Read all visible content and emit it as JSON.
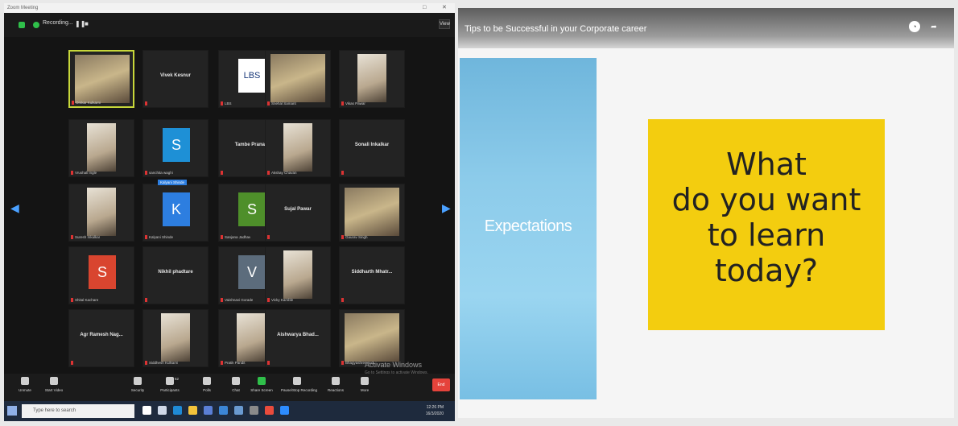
{
  "zoom": {
    "window_title": "Zoom Meeting",
    "window_controls": [
      "□",
      "✕"
    ],
    "recording_label": "Recording...",
    "view_label": "View",
    "watermark_title": "Activate Windows",
    "watermark_sub": "Go to Settings to activate Windows.",
    "tiles": [
      {
        "name": "Omkar Kulkarni",
        "kind": "photo",
        "active": true
      },
      {
        "name": "Vivek Kesnur",
        "kind": "name"
      },
      {
        "name": "LBS",
        "kind": "logo",
        "letters": "LBS"
      },
      {
        "name": "Snehal Samant",
        "kind": "photo"
      },
      {
        "name": "Vikas Pawar",
        "kind": "tallphoto"
      },
      {
        "name": "Vrushali Ingle",
        "kind": "tallphoto"
      },
      {
        "name": "sanchita waghi",
        "kind": "avatar",
        "letter": "S",
        "color": "#1e90d6"
      },
      {
        "name": "Tambe Pranav",
        "kind": "name"
      },
      {
        "name": "Akshay Chavan",
        "kind": "tallphoto"
      },
      {
        "name": "Sonali Inkalkar",
        "kind": "name"
      },
      {
        "name": "Suresh Inkalkar",
        "kind": "tallphoto"
      },
      {
        "name": "Kalyani Shinde",
        "kind": "avatar",
        "letter": "K",
        "color": "#2d7ee0",
        "badge": "Kalyani Shinde"
      },
      {
        "name": "Sanjana Jadhav",
        "kind": "avatar",
        "letter": "S",
        "color": "#4e8f2a"
      },
      {
        "name": "Sujal Pawar",
        "kind": "name"
      },
      {
        "name": "Gaurav Singh",
        "kind": "photo"
      },
      {
        "name": "Shital Kachare",
        "kind": "avatar",
        "letter": "S",
        "color": "#d9452f"
      },
      {
        "name": "Nikhil phadtare",
        "kind": "name"
      },
      {
        "name": "Vaishnavi Gorade",
        "kind": "avatar",
        "letter": "V",
        "color": "#5c6c7c"
      },
      {
        "name": "Vicky Kamble",
        "kind": "tallphoto"
      },
      {
        "name": "Siddharth Mhatr...",
        "kind": "name"
      },
      {
        "name": "Agr Ramesh Nag...",
        "kind": "name"
      },
      {
        "name": "Siddhesh Kulkarni",
        "kind": "tallphoto"
      },
      {
        "name": "Pratik Pandit",
        "kind": "tallphoto"
      },
      {
        "name": "Aishwarya Bhad...",
        "kind": "name"
      },
      {
        "name": "Bhagyashree sud...",
        "kind": "photo"
      }
    ],
    "toolbar": [
      {
        "label": "Unmute",
        "icon": "microphone-icon"
      },
      {
        "label": "Start Video",
        "icon": "video-camera-icon"
      },
      {
        "label": "Security",
        "icon": "shield-icon"
      },
      {
        "label": "Participants",
        "icon": "participants-icon",
        "count": "62"
      },
      {
        "label": "Polls",
        "icon": "polls-icon"
      },
      {
        "label": "Chat",
        "icon": "chat-icon"
      },
      {
        "label": "Share Screen",
        "icon": "share-screen-icon",
        "color": "#2fbf4a"
      },
      {
        "label": "Pause/Stop Recording",
        "icon": "record-icon"
      },
      {
        "label": "Reactions",
        "icon": "reactions-icon"
      },
      {
        "label": "More",
        "icon": "more-icon"
      }
    ],
    "end_label": "End"
  },
  "taskbar": {
    "search_placeholder": "Type here to search",
    "time": "12:26 PM",
    "date": "16/3/2020",
    "apps": [
      {
        "icon": "cortana-icon",
        "color": "#ffffff"
      },
      {
        "icon": "task-view-icon",
        "color": "#cfd8e8"
      },
      {
        "icon": "edge-icon",
        "color": "#1f8ad6"
      },
      {
        "icon": "file-explorer-icon",
        "color": "#f2c33b"
      },
      {
        "icon": "store-icon",
        "color": "#5a7fd6"
      },
      {
        "icon": "mail-icon",
        "color": "#3c86d6"
      },
      {
        "icon": "photos-icon",
        "color": "#6a9ad0"
      },
      {
        "icon": "settings-icon",
        "color": "#8a8a8a"
      },
      {
        "icon": "chrome-icon",
        "color": "#e94b3c"
      },
      {
        "icon": "zoom-app-icon",
        "color": "#2d8cff"
      }
    ]
  },
  "slide": {
    "title": "Tips to be Successful in your Corporate career",
    "left_text": "Expectations",
    "sticky_note": "What\ndo you want\nto learn\ntoday?"
  }
}
